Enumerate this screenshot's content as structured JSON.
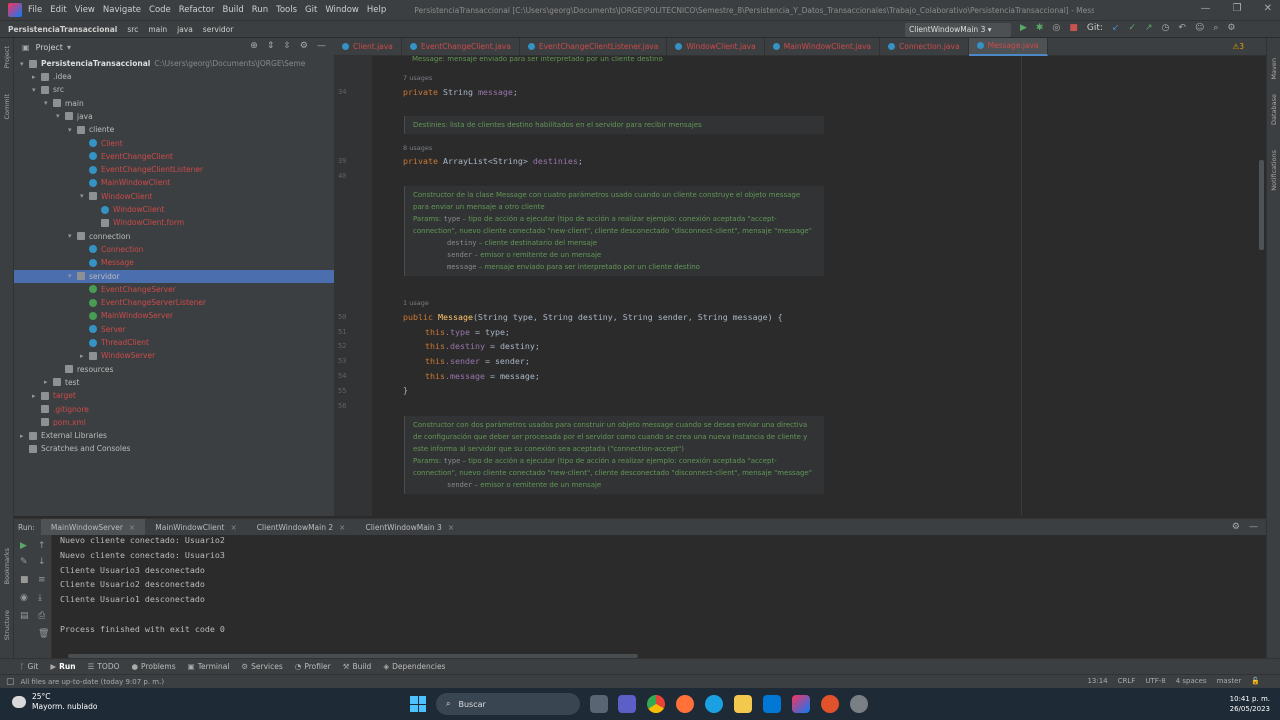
{
  "titlebar": {
    "menu": [
      "File",
      "Edit",
      "View",
      "Navigate",
      "Code",
      "Refactor",
      "Build",
      "Run",
      "Tools",
      "Git",
      "Window",
      "Help"
    ],
    "title": "PersistenciaTransaccional [C:\\Users\\georg\\Documents\\JORGE\\POLITECNICO\\Semestre_8\\Persistencia_Y_Datos_Transaccionales\\Trabajo_Colaborativo\\PersistenciaTransaccional] - Message.java"
  },
  "navbar": {
    "crumbs": [
      "PersistenciaTransaccional",
      "src",
      "main",
      "java",
      "servidor"
    ],
    "run_config": "ClientWindowMain 3",
    "git_label": "Git:"
  },
  "project": {
    "header": "Project",
    "root_label": "PersistenciaTransaccional",
    "root_path": "C:\\Users\\georg\\Documents\\JORGE\\Seme",
    "tree": [
      {
        "label": ".idea",
        "depth": 1,
        "type": "folder",
        "state": "normal",
        "arrow": "▸"
      },
      {
        "label": "src",
        "depth": 1,
        "type": "folder",
        "state": "normal",
        "arrow": "▾"
      },
      {
        "label": "main",
        "depth": 2,
        "type": "folder",
        "state": "normal",
        "arrow": "▾"
      },
      {
        "label": "java",
        "depth": 3,
        "type": "folder",
        "state": "normal",
        "arrow": "▾"
      },
      {
        "label": "cliente",
        "depth": 4,
        "type": "folder",
        "state": "normal",
        "arrow": "▾"
      },
      {
        "label": "Client",
        "depth": 5,
        "type": "class",
        "state": "error",
        "arrow": ""
      },
      {
        "label": "EventChangeClient",
        "depth": 5,
        "type": "class",
        "state": "error",
        "arrow": ""
      },
      {
        "label": "EventChangeClientListener",
        "depth": 5,
        "type": "class",
        "state": "error",
        "arrow": ""
      },
      {
        "label": "MainWindowClient",
        "depth": 5,
        "type": "class",
        "state": "error",
        "arrow": ""
      },
      {
        "label": "WindowClient",
        "depth": 5,
        "type": "form",
        "state": "error",
        "arrow": "▾"
      },
      {
        "label": "WindowClient",
        "depth": 6,
        "type": "class",
        "state": "error",
        "arrow": ""
      },
      {
        "label": "WindowClient.form",
        "depth": 6,
        "type": "form",
        "state": "error",
        "arrow": ""
      },
      {
        "label": "connection",
        "depth": 4,
        "type": "folder",
        "state": "normal",
        "arrow": "▾"
      },
      {
        "label": "Connection",
        "depth": 5,
        "type": "class",
        "state": "error",
        "arrow": ""
      },
      {
        "label": "Message",
        "depth": 5,
        "type": "class",
        "state": "error",
        "arrow": ""
      },
      {
        "label": "servidor",
        "depth": 4,
        "type": "folder",
        "state": "selected",
        "arrow": "▾"
      },
      {
        "label": "EventChangeServer",
        "depth": 5,
        "type": "classg",
        "state": "error",
        "arrow": ""
      },
      {
        "label": "EventChangeServerListener",
        "depth": 5,
        "type": "classg",
        "state": "error",
        "arrow": ""
      },
      {
        "label": "MainWindowServer",
        "depth": 5,
        "type": "classg",
        "state": "error",
        "arrow": ""
      },
      {
        "label": "Server",
        "depth": 5,
        "type": "class",
        "state": "error",
        "arrow": ""
      },
      {
        "label": "ThreadClient",
        "depth": 5,
        "type": "class",
        "state": "error",
        "arrow": ""
      },
      {
        "label": "WindowServer",
        "depth": 5,
        "type": "form",
        "state": "error",
        "arrow": "▸"
      },
      {
        "label": "resources",
        "depth": 3,
        "type": "folder",
        "state": "normal",
        "arrow": ""
      },
      {
        "label": "test",
        "depth": 2,
        "type": "folder",
        "state": "normal",
        "arrow": "▸"
      },
      {
        "label": "target",
        "depth": 1,
        "type": "folder",
        "state": "error",
        "arrow": "▸"
      },
      {
        "label": ".gitignore",
        "depth": 1,
        "type": "file",
        "state": "error",
        "arrow": ""
      },
      {
        "label": "pom.xml",
        "depth": 1,
        "type": "file",
        "state": "error",
        "arrow": ""
      },
      {
        "label": "External Libraries",
        "depth": 0,
        "type": "lib",
        "state": "normal",
        "arrow": "▸"
      },
      {
        "label": "Scratches and Consoles",
        "depth": 0,
        "type": "lib",
        "state": "normal",
        "arrow": ""
      }
    ]
  },
  "editor": {
    "tabs": [
      {
        "label": "Client.java",
        "active": false
      },
      {
        "label": "EventChangeClient.java",
        "active": false
      },
      {
        "label": "EventChangeClientListener.java",
        "active": false
      },
      {
        "label": "WindowClient.java",
        "active": false
      },
      {
        "label": "MainWindowClient.java",
        "active": false
      },
      {
        "label": "Connection.java",
        "active": false
      },
      {
        "label": "Message.java",
        "active": true
      }
    ],
    "warnings": "⚠3",
    "top_doc": "Message: mensaje enviado para ser interpretado por un cliente destino",
    "usages_7": "7 usages",
    "line34": "34",
    "decl_message": {
      "kw": "private",
      "type": " String ",
      "name": "message",
      "end": ";"
    },
    "doc_destinies": "Destinies: lista de clientes destino habilitados en el servidor para recibir mensajes",
    "usages_8": "8 usages",
    "line39": "39",
    "line40": "40",
    "decl_destinies": {
      "kw": "private",
      "type": " ArrayList<String> ",
      "name": "destinies",
      "end": ";"
    },
    "doc_constructor1": {
      "desc": "Constructor de la clase Message con cuatro parámetros usado cuando un cliente construye el objeto message para enviar un mensaje a otro cliente",
      "params_label": "Params:",
      "type_name": "type",
      "type_desc": " – tipo de acción a ejecutar (tipo de acción a realizar ejemplo: conexión aceptada \"accept-connection\", nuevo cliente conectado \"new-client\", cliente desconectado \"disconnect-client\", mensaje \"message\"",
      "destiny_name": "destiny",
      "destiny_desc": " – cliente destinatario del mensaje",
      "sender_name": "sender",
      "sender_desc": " – emisor o remitente de un mensaje",
      "message_name": "message",
      "message_desc": " – mensaje enviado para ser interpretado por un cliente destino"
    },
    "usages_1": "1 usage",
    "lines_ctor": [
      "50",
      "51",
      "52",
      "53",
      "54",
      "55",
      "56"
    ],
    "ctor_sig": {
      "kw": "public ",
      "name": "Message",
      "rest": "(String type, String destiny, String sender, String message) {"
    },
    "ctor_body": [
      {
        "this": "this",
        "field": ".type",
        "rest": " = type;"
      },
      {
        "this": "this",
        "field": ".destiny",
        "rest": " = destiny;"
      },
      {
        "this": "this",
        "field": ".sender",
        "rest": " = sender;"
      },
      {
        "this": "this",
        "field": ".message",
        "rest": " = message;"
      }
    ],
    "close_brace": "}",
    "doc_constructor2": {
      "desc": "Constructor con dos parámetros usados para construir un objeto message cuando se desea enviar una directiva de configuración que deber ser procesada por el servidor como cuando se crea una nueva instancia de cliente y este informa al servidor que su conexión sea aceptada (\"connection-accept\")",
      "params_label": "Params:",
      "type_name": "type",
      "type_desc": " – tipo de acción a ejecutar (tipo de acción a realizar ejemplo: conexión aceptada \"accept-connection\", nuevo cliente conectado \"new-client\", cliente desconectado \"disconnect-client\", mensaje \"message\"",
      "sender_name": "sender",
      "sender_desc": " – emisor o remitente de un mensaje"
    }
  },
  "run": {
    "label": "Run:",
    "tabs": [
      {
        "label": "MainWindowServer",
        "active": true
      },
      {
        "label": "MainWindowClient",
        "active": false
      },
      {
        "label": "ClientWindowMain 2",
        "active": false
      },
      {
        "label": "ClientWindowMain 3",
        "active": false
      }
    ],
    "console": [
      "Nuevo cliente conectado: Usuario2",
      "Nuevo cliente conectado: Usuario3",
      "Cliente Usuario3 desconectado",
      "Cliente Usuario2 desconectado",
      "Cliente Usuario1 desconectado",
      "",
      "Process finished with exit code 0"
    ]
  },
  "toolwindows": [
    {
      "label": "Git",
      "icon": "ᚴ",
      "active": false
    },
    {
      "label": "Run",
      "icon": "▶",
      "active": true
    },
    {
      "label": "TODO",
      "icon": "☰",
      "active": false
    },
    {
      "label": "Problems",
      "icon": "●",
      "active": false
    },
    {
      "label": "Terminal",
      "icon": "▣",
      "active": false
    },
    {
      "label": "Services",
      "icon": "⚙",
      "active": false
    },
    {
      "label": "Profiler",
      "icon": "◔",
      "active": false
    },
    {
      "label": "Build",
      "icon": "⚒",
      "active": false
    },
    {
      "label": "Dependencies",
      "icon": "◈",
      "active": false
    }
  ],
  "status": {
    "message": "All files are up-to-date (today 9:07 p. m.)",
    "position": "13:14",
    "line_sep": "CRLF",
    "encoding": "UTF-8",
    "indent": "4 spaces",
    "branch": "master"
  },
  "side_labels": {
    "project": "Project",
    "commit": "Commit",
    "bookmarks": "Bookmarks",
    "structure": "Structure",
    "maven": "Maven",
    "database": "Database",
    "notifications": "Notifications"
  },
  "taskbar": {
    "temp": "25°C",
    "weather": "Mayorm. nublado",
    "search": "Buscar",
    "time": "10:41 p. m.",
    "date": "26/05/2023"
  }
}
